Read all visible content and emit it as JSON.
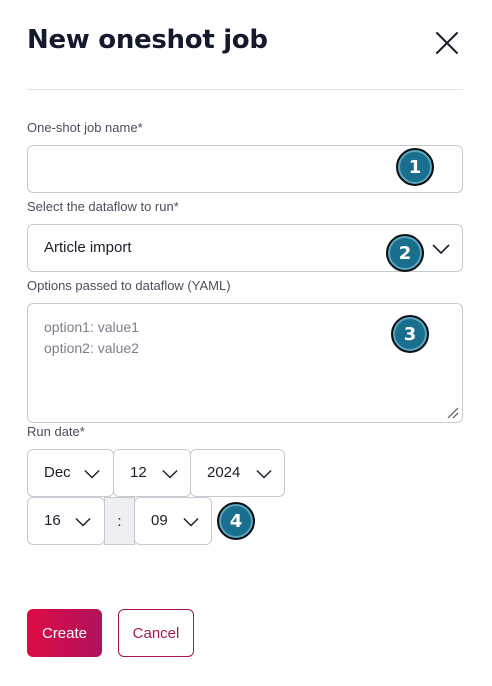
{
  "dialog": {
    "title": "New oneshot job",
    "close_icon": "close-icon"
  },
  "form": {
    "job_name": {
      "label": "One-shot job name*",
      "value": "",
      "placeholder": ""
    },
    "dataflow": {
      "label": "Select the dataflow to run*",
      "selected": "Article import"
    },
    "options": {
      "label": "Options passed to dataflow (YAML)",
      "placeholder": "option1: value1\noption2: value2"
    },
    "run_date": {
      "label": "Run date*",
      "month": "Dec",
      "day": "12",
      "year": "2024",
      "hour": "16",
      "separator": ":",
      "minute": "09"
    }
  },
  "markers": [
    "1",
    "2",
    "3",
    "4"
  ],
  "buttons": {
    "create": "Create",
    "cancel": "Cancel"
  },
  "colors": {
    "primary_gradient_start": "#de0b45",
    "primary_gradient_end": "#b0125d",
    "cancel_accent": "#a91557",
    "marker_fill": "#1a6e8e",
    "border": "#c8cad1"
  }
}
